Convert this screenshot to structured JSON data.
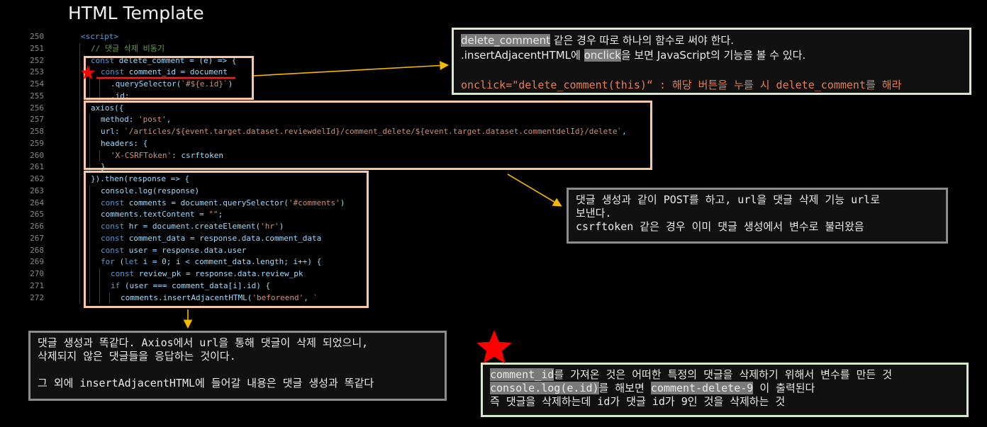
{
  "title": "HTML Template",
  "code": {
    "lines": [
      {
        "no": "250",
        "text": "<script>"
      },
      {
        "no": "251",
        "text": "// 댓글 삭제 비동기"
      },
      {
        "no": "252",
        "text": "const delete_comment = (e) => {"
      },
      {
        "no": "253",
        "text": "const comment_id = document"
      },
      {
        "no": "254",
        "text": ".querySelector(`#${e.id}`)"
      },
      {
        "no": "255",
        "text": ".id;"
      },
      {
        "no": "256",
        "text": "axios({"
      },
      {
        "no": "257",
        "text": "method: 'post',"
      },
      {
        "no": "258",
        "text": "url: `/articles/${event.target.dataset.reviewdelId}/comment_delete/${event.target.dataset.commentdelId}/delete`,"
      },
      {
        "no": "259",
        "text": "headers: {"
      },
      {
        "no": "260",
        "text": "'X-CSRFToken': csrftoken"
      },
      {
        "no": "261",
        "text": "}"
      },
      {
        "no": "262",
        "text": "}).then(response => {"
      },
      {
        "no": "263",
        "text": "console.log(response)"
      },
      {
        "no": "264",
        "text": "const comments = document.querySelector('#comments')"
      },
      {
        "no": "265",
        "text": "comments.textContent = \"\";"
      },
      {
        "no": "266",
        "text": "const hr = document.createElement('hr')"
      },
      {
        "no": "267",
        "text": "const comment_data = response.data.comment_data"
      },
      {
        "no": "268",
        "text": "const user = response.data.user"
      },
      {
        "no": "269",
        "text": "for (let i = 0; i < comment_data.length; i++) {"
      },
      {
        "no": "270",
        "text": "const review_pk = response.data.review_pk"
      },
      {
        "no": "271",
        "text": "if (user === comment_data[i].id) {"
      },
      {
        "no": "272",
        "text": "comments.insertAdjacentHTML('beforeend', `"
      }
    ]
  },
  "note1": {
    "l1_hl": "delete_comment",
    "l1_rest": " 같은 경우 따로 하나의 함수로 써야 한다.",
    "l2_a": ".insertAdjacentHTML",
    "l2_b": "에 ",
    "l2_hl": "onclick",
    "l2_c": "을 보면 JavaScript의 기능을 볼 수 있다.",
    "l3": "onclick=\"delete_comment(this)“ : 해당 버튼을 누를 시 delete_comment를 해라"
  },
  "note2": {
    "l1": "댓글 생성과 같이 POST를 하고, url을 댓글 삭제 기능 url로",
    "l2": "보낸다.",
    "l3": "csrftoken 같은 경우 이미 댓글 생성에서 변수로 불러왔음"
  },
  "note3": {
    "l1": "댓글 생성과 똑같다. Axios에서 url을 통해 댓글이 삭제 되었으니,",
    "l2": "삭제되지 않은 댓글들을 응답하는 것이다.",
    "l3": "그 외에 insertAdjacentHTML에 들어갈 내용은 댓글 생성과 똑같다"
  },
  "note4": {
    "l1_hl": "comment_id",
    "l1_rest": "를 가져온 것은 어떠한 특정의 댓글을 삭제하기 위해서 변수를 만든 것",
    "l2_hl": "console.log(e.id)",
    "l2_mid": "를 해보면 ",
    "l2_hl2": "comment-delete-9",
    "l2_rest": " 이 출력된다",
    "l3": "즉 댓글을 삭제하는데 id가 댓글 id가 9인 것을 삭제하는 것"
  },
  "colors": {
    "background": "#000000",
    "peach_box": "#f6c9a4",
    "green_box": "#d6e9cf",
    "gray_box": "#8c8c8c",
    "arrow": "#f5b800",
    "star": "#ff0000",
    "keyword": "#569cd6",
    "string": "#ce9178",
    "comment": "#6a9955"
  },
  "icons": [
    "star-icon",
    "arrow-icon"
  ]
}
